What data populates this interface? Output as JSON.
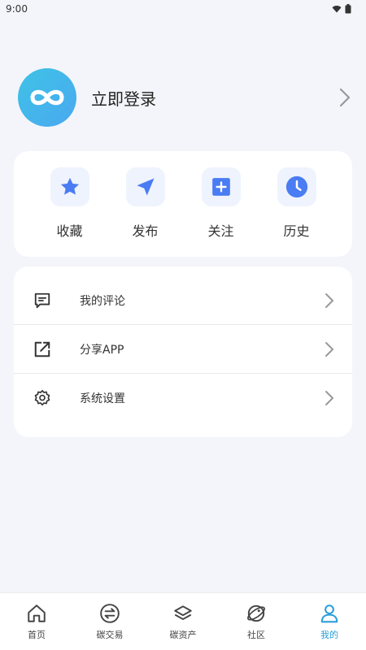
{
  "status_bar": {
    "time": "9:00"
  },
  "profile": {
    "login_label": "立即登录"
  },
  "quick_actions": [
    {
      "label": "收藏",
      "icon": "star-icon"
    },
    {
      "label": "发布",
      "icon": "send-icon"
    },
    {
      "label": "关注",
      "icon": "plus-square-icon"
    },
    {
      "label": "历史",
      "icon": "clock-icon"
    }
  ],
  "menu": [
    {
      "label": "我的评论",
      "icon": "comment-icon"
    },
    {
      "label": "分享APP",
      "icon": "share-icon"
    },
    {
      "label": "系统设置",
      "icon": "gear-icon"
    }
  ],
  "tabs": [
    {
      "label": "首页",
      "icon": "home-icon"
    },
    {
      "label": "碳交易",
      "icon": "exchange-icon"
    },
    {
      "label": "碳资产",
      "icon": "layers-icon"
    },
    {
      "label": "社区",
      "icon": "planet-icon"
    },
    {
      "label": "我的",
      "icon": "user-icon",
      "active": true
    }
  ],
  "colors": {
    "accent": "#4a7cf3",
    "tab_active": "#2a9fd8",
    "background": "#f4f5fa"
  }
}
